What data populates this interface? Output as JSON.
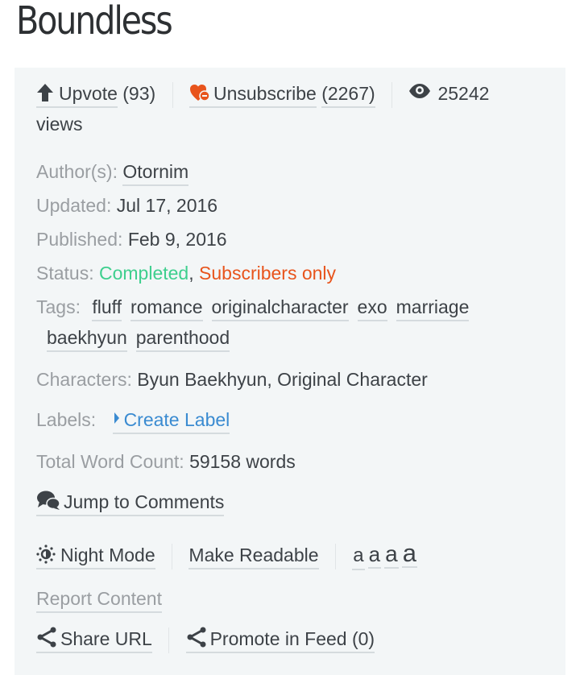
{
  "title": "Boundless",
  "actions": {
    "upvote_label": "Upvote",
    "upvote_count": "(93)",
    "unsubscribe_label": "Unsubscribe",
    "unsubscribe_count": "(2267)",
    "views_count": "25242",
    "views_label": "views"
  },
  "meta": {
    "author_label": "Author(s):",
    "author": "Otornim",
    "updated_label": "Updated:",
    "updated": "Jul 17, 2016",
    "published_label": "Published:",
    "published": "Feb 9, 2016",
    "status_label": "Status:",
    "status_completed": "Completed",
    "status_comma": ",",
    "status_subscribers": "Subscribers only",
    "tags_label": "Tags:",
    "tags": [
      "fluff",
      "romance",
      "originalcharacter",
      "exo",
      "marriage",
      "baekhyun",
      "parenthood"
    ],
    "characters_label": "Characters:",
    "characters": "Byun Baekhyun, Original Character",
    "labels_label": "Labels:",
    "create_label": "Create Label",
    "word_count_label": "Total Word Count:",
    "word_count": "59158 words"
  },
  "tools": {
    "jump_to_comments": "Jump to Comments",
    "night_mode": "Night Mode",
    "make_readable": "Make Readable",
    "font_sizes": [
      "a",
      "a",
      "a",
      "a"
    ],
    "report_content": "Report Content",
    "share_url": "Share URL",
    "promote_in_feed": "Promote in Feed (0)"
  },
  "colors": {
    "accent_orange": "#e8541c",
    "status_green": "#3ecf8e",
    "link_blue": "#3a8bd1",
    "panel_bg": "#f3f6f7"
  }
}
